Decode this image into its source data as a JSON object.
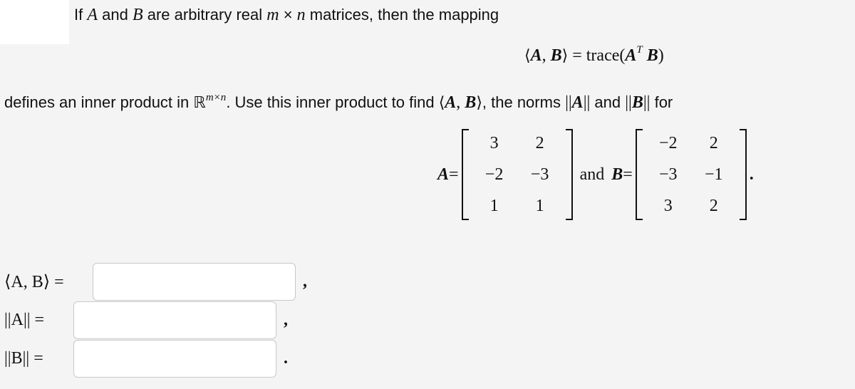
{
  "intro": {
    "line1_prefix": "If ",
    "var_a": "A",
    "and_word": " and ",
    "var_b": "B",
    "line1_mid": " are arbitrary real ",
    "var_m": "m",
    "times": " × ",
    "var_n": "n",
    "line1_suffix": " matrices, then the mapping"
  },
  "definition": {
    "lhs_open": "⟨",
    "lhs_a": "A",
    "lhs_comma": ", ",
    "lhs_b": "B",
    "lhs_close": "⟩",
    "equals": " = trace(",
    "rhs_a": "A",
    "rhs_sup": "T",
    "rhs_b": " B",
    "rhs_close": ")"
  },
  "line2": {
    "prefix": "defines an inner product in ",
    "real_symbol": "ℝ",
    "superscript": "m×n",
    "mid": ". Use this inner product to find ",
    "ip_open": "⟨",
    "ip_a": "A",
    "ip_comma": ", ",
    "ip_b": "B",
    "ip_close": "⟩",
    "norms_text": ", the norms ",
    "norm_a_open": "||",
    "norm_a": "A",
    "norm_a_close": "||",
    "and_text": " and ",
    "norm_b_open": "||",
    "norm_b": "B",
    "norm_b_close": "||",
    "suffix": " for"
  },
  "matrices": {
    "a_label": "A",
    "a_equals": " =",
    "a_rows": [
      [
        "3",
        "2"
      ],
      [
        "−2",
        "−3"
      ],
      [
        "1",
        "1"
      ]
    ],
    "and_word": "and",
    "b_label": "B",
    "b_equals": " =",
    "b_rows": [
      [
        "−2",
        "2"
      ],
      [
        "−3",
        "−1"
      ],
      [
        "3",
        "2"
      ]
    ],
    "end_period": "."
  },
  "answers": [
    {
      "label": "⟨A, B⟩ =",
      "value": "",
      "placeholder": "",
      "punct": ","
    },
    {
      "label": "||A|| =",
      "value": "",
      "placeholder": "",
      "punct": ","
    },
    {
      "label": "||B|| =",
      "value": "",
      "placeholder": "",
      "punct": "."
    }
  ]
}
